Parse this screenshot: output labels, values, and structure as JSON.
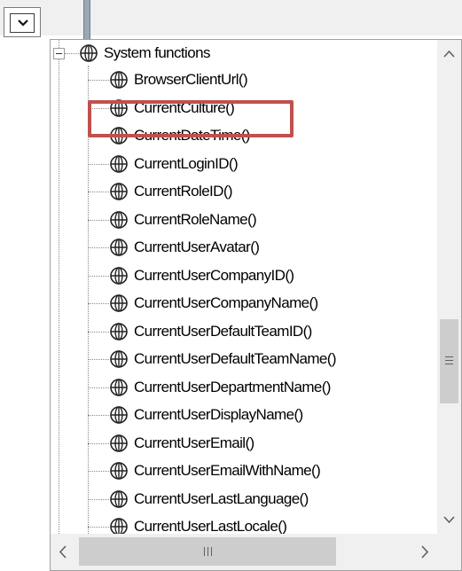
{
  "toolbar": {
    "dropdown_icon": "chevron-down-icon"
  },
  "tree": {
    "root": {
      "label": "System functions",
      "icon": "globe-icon",
      "expanded": true
    },
    "selected_index": 1,
    "items": [
      {
        "label": "BrowserClientUrl()"
      },
      {
        "label": "CurrentCulture()"
      },
      {
        "label": "CurrentDateTime()"
      },
      {
        "label": "CurrentLoginID()"
      },
      {
        "label": "CurrentRoleID()"
      },
      {
        "label": "CurrentRoleName()"
      },
      {
        "label": "CurrentUserAvatar()"
      },
      {
        "label": "CurrentUserCompanyID()"
      },
      {
        "label": "CurrentUserCompanyName()"
      },
      {
        "label": "CurrentUserDefaultTeamID()"
      },
      {
        "label": "CurrentUserDefaultTeamName()"
      },
      {
        "label": "CurrentUserDepartmentName()"
      },
      {
        "label": "CurrentUserDisplayName()"
      },
      {
        "label": "CurrentUserEmail()"
      },
      {
        "label": "CurrentUserEmailWithName()"
      },
      {
        "label": "CurrentUserLastLanguage()"
      },
      {
        "label": "CurrentUserLastLocale()"
      }
    ]
  },
  "colors": {
    "highlight": "#c0504d",
    "scrollbar_track": "#f0f0f0",
    "scrollbar_thumb": "#cdcdcd"
  }
}
